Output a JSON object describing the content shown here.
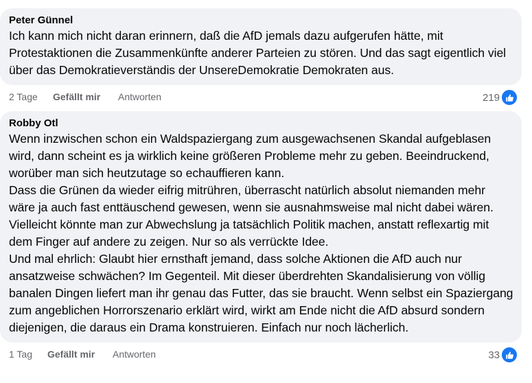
{
  "comments": [
    {
      "author": "Peter Günnel",
      "text": "Ich kann mich nicht daran erinnern, daß die AfD jemals dazu aufgerufen hätte, mit Protestaktionen die Zusammenkünfte anderer Parteien zu stören. Und das sagt eigentlich viel über das Demokratieverständis der UnsereDemokratie Demokraten aus.",
      "time": "2 Tage",
      "like_label": "Gefällt mir",
      "reply_label": "Antworten",
      "reaction_count": "219",
      "reaction_icon": "thumbs-up-icon"
    },
    {
      "author": "Robby Otl",
      "text": "Wenn inzwischen schon ein Waldspaziergang zum ausgewachsenen Skandal aufgeblasen wird, dann scheint es ja wirklich keine größeren Probleme mehr zu geben. Beeindruckend, worüber man sich heutzutage so echauffieren kann.\nDass die Grünen da wieder eifrig mitrühren, überrascht natürlich absolut niemanden mehr wäre ja auch fast enttäuschend gewesen, wenn sie ausnahmsweise mal nicht dabei wären. Vielleicht könnte man zur Abwechslung ja tatsächlich Politik machen, anstatt reflexartig mit dem Finger auf andere zu zeigen. Nur so als verrückte Idee.\nUnd mal ehrlich: Glaubt hier ernsthaft jemand, dass solche Aktionen die AfD auch nur ansatzweise schwächen? Im Gegenteil. Mit dieser überdrehten Skandalisierung von völlig banalen Dingen liefert man ihr genau das Futter, das sie braucht. Wenn selbst ein Spaziergang zum angeblichen Horrorszenario erklärt wird, wirkt am Ende nicht die AfD absurd sondern diejenigen, die daraus ein Drama konstruieren. Einfach nur noch lächerlich.",
      "time": "1 Tag",
      "like_label": "Gefällt mir",
      "reply_label": "Antworten",
      "reaction_count": "33",
      "reaction_icon": "thumbs-up-icon"
    }
  ],
  "colors": {
    "bubble": "#f0f2f5",
    "text": "#050505",
    "meta": "#65676b",
    "reaction": "#1877f2"
  }
}
